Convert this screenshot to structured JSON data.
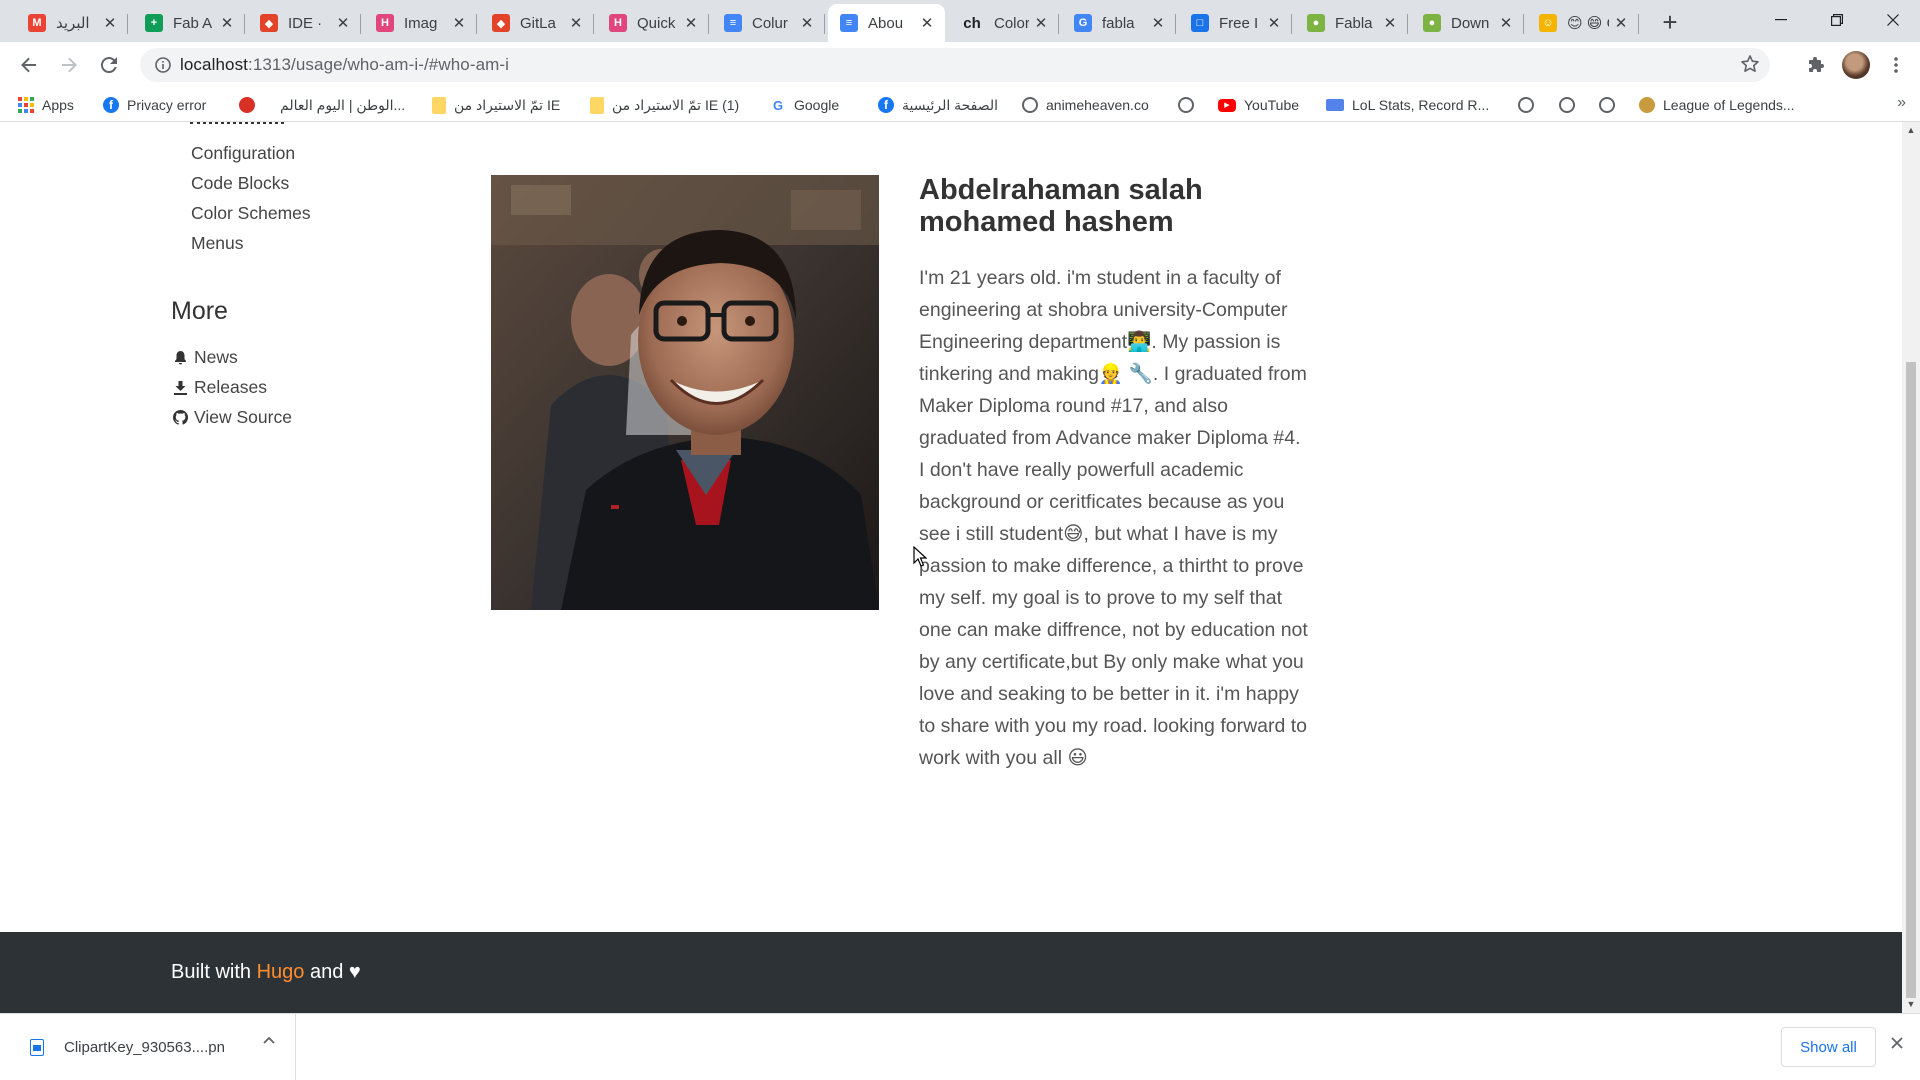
{
  "browser": {
    "tabs": [
      {
        "title": "البريد",
        "favicon": "gmail-icon",
        "color": "#ea4335",
        "glyph": "M",
        "active": false
      },
      {
        "title": "Fab A",
        "favicon": "sheets-icon",
        "color": "#0f9d58",
        "glyph": "+",
        "active": false
      },
      {
        "title": "IDE ·",
        "favicon": "gitlab-icon",
        "color": "#e24329",
        "glyph": "◆",
        "active": false
      },
      {
        "title": "Imag",
        "favicon": "hugo-icon",
        "color": "#e0457b",
        "glyph": "H",
        "active": false
      },
      {
        "title": "GitLa",
        "favicon": "gitlab-icon",
        "color": "#e24329",
        "glyph": "◆",
        "active": false
      },
      {
        "title": "Quick",
        "favicon": "hugo-icon",
        "color": "#e0457b",
        "glyph": "H",
        "active": false
      },
      {
        "title": "Colur",
        "favicon": "doc-icon",
        "color": "#4285f4",
        "glyph": "≡",
        "active": false
      },
      {
        "title": "Abou",
        "favicon": "doc-icon",
        "color": "#4285f4",
        "glyph": "≡",
        "active": true
      },
      {
        "title": "Color",
        "favicon": "ch-icon",
        "color": "#202124",
        "glyph": "ch",
        "active": false
      },
      {
        "title": "fabla",
        "favicon": "google-icon",
        "color": "#4285f4",
        "glyph": "G",
        "active": false
      },
      {
        "title": "Free I",
        "favicon": "square-icon",
        "color": "#1a73e8",
        "glyph": "□",
        "active": false
      },
      {
        "title": "Fabla",
        "favicon": "fablab-icon",
        "color": "#7cb342",
        "glyph": "●",
        "active": false
      },
      {
        "title": "Down",
        "favicon": "fablab-icon",
        "color": "#7cb342",
        "glyph": "●",
        "active": false
      },
      {
        "title": "😊 😄 G",
        "favicon": "emoji-icon",
        "color": "#f4b400",
        "glyph": "☺",
        "active": false
      }
    ],
    "url_host": "localhost",
    "url_rest": ":1313/usage/who-am-i-/#who-am-i",
    "bookmarks": [
      {
        "label": "Apps",
        "icon": "apps-icon",
        "color": "#4285f4"
      },
      {
        "label": "Privacy error",
        "icon": "facebook-icon",
        "color": "#1877f2"
      },
      {
        "label": "",
        "icon": "red-pin-icon",
        "color": "#d93025"
      },
      {
        "label": "الوطن | اليوم العالم...",
        "icon": "",
        "color": ""
      },
      {
        "label": "تمّ الاستيراد من IE",
        "icon": "folder-icon",
        "color": "#fdd663"
      },
      {
        "label": "تمّ الاستيراد من IE (1)",
        "icon": "folder-icon",
        "color": "#fdd663"
      },
      {
        "label": "Google",
        "icon": "google-icon",
        "color": "#4285f4"
      },
      {
        "label": "الصفحة الرئيسية",
        "icon": "facebook-icon",
        "color": "#1877f2"
      },
      {
        "label": "animeheaven.co",
        "icon": "globe-icon",
        "color": "#5f6368"
      },
      {
        "label": "",
        "icon": "globe-icon",
        "color": "#5f6368"
      },
      {
        "label": "YouTube",
        "icon": "youtube-icon",
        "color": "#ff0000"
      },
      {
        "label": "LoL Stats, Record R...",
        "icon": "lol-stats-icon",
        "color": "#5383e8"
      },
      {
        "label": "",
        "icon": "globe-icon",
        "color": "#5f6368"
      },
      {
        "label": "",
        "icon": "globe-icon",
        "color": "#5f6368"
      },
      {
        "label": "",
        "icon": "globe-icon",
        "color": "#5f6368"
      },
      {
        "label": "League of Legends...",
        "icon": "lol-icon",
        "color": "#c89b3c"
      }
    ],
    "bookmarks_overflow": "»"
  },
  "sidebar": {
    "nav_items": [
      "Configuration",
      "Code Blocks",
      "Color Schemes",
      "Menus"
    ],
    "more_title": "More",
    "more_items": [
      {
        "label": "News",
        "icon": "bell-icon"
      },
      {
        "label": "Releases",
        "icon": "download-icon"
      },
      {
        "label": "View Source",
        "icon": "github-icon"
      }
    ]
  },
  "profile": {
    "name": "Abdelrahaman salah mohamed hashem",
    "bio": "I'm 21 years old. i'm student in a faculty of engineering at shobra university-Computer Engineering department👨‍💻. My passion is tinkering and making👷 🔧. I graduated from Maker Diploma round #17, and also graduated from Advance maker Diploma #4. I don't have really powerfull academic background or ceritficates because as you see i still student😅, but what I have is my passion to make difference, a thirtht to prove my self. my goal is to prove to my self that one can make diffrence, not by education not by any certificate,but By only make what you love and seaking to be better in it. i'm happy to share with you my road. looking forward to work with you all 😃"
  },
  "footer": {
    "built_with": "Built with",
    "hugo": "Hugo",
    "and": "and",
    "heart": "♥"
  },
  "downloads": {
    "file_name": "ClipartKey_930563....pn",
    "show_all": "Show all"
  }
}
